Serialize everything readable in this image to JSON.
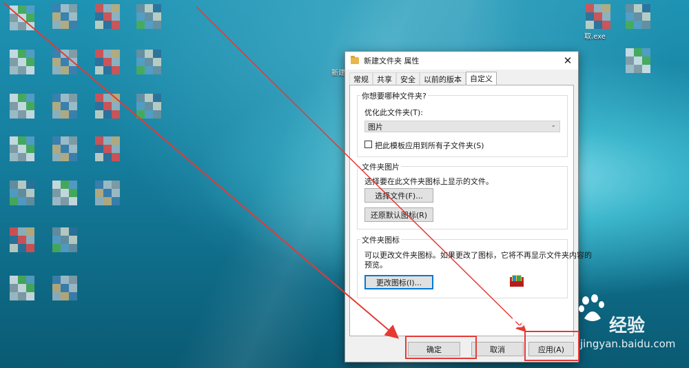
{
  "desktop": {
    "partial_labels": [
      "新建",
      "取.exe"
    ]
  },
  "dialog": {
    "title": "新建文件夹 属性",
    "close_glyph": "✕",
    "tabs": [
      "常规",
      "共享",
      "安全",
      "以前的版本",
      "自定义"
    ],
    "active_tab": "自定义",
    "optimize_group": {
      "title": "你想要哪种文件夹?",
      "label": "优化此文件夹(T):",
      "selected": "图片",
      "checkbox_label": "把此模板应用到所有子文件夹(S)",
      "checkbox_checked": false
    },
    "picture_group": {
      "title": "文件夹图片",
      "description": "选择要在此文件夹图标上显示的文件。",
      "choose_button": "选择文件(F)...",
      "restore_button": "还原默认图标(R)"
    },
    "icon_group": {
      "title": "文件夹图标",
      "description_line1": "可以更改文件夹图标。如果更改了图标，它将不再显示文件夹内容的",
      "description_line2": "预览。",
      "change_button": "更改图标(I)..."
    },
    "footer": {
      "ok": "确定",
      "cancel": "取消",
      "apply": "应用(A)"
    }
  },
  "watermark": {
    "brand": "Baidu",
    "brand_cn": "经验",
    "url": "jingyan.baidu.com"
  },
  "colors": {
    "annotation_red": "#e53935",
    "desktop_blue": "#1a8cad"
  }
}
